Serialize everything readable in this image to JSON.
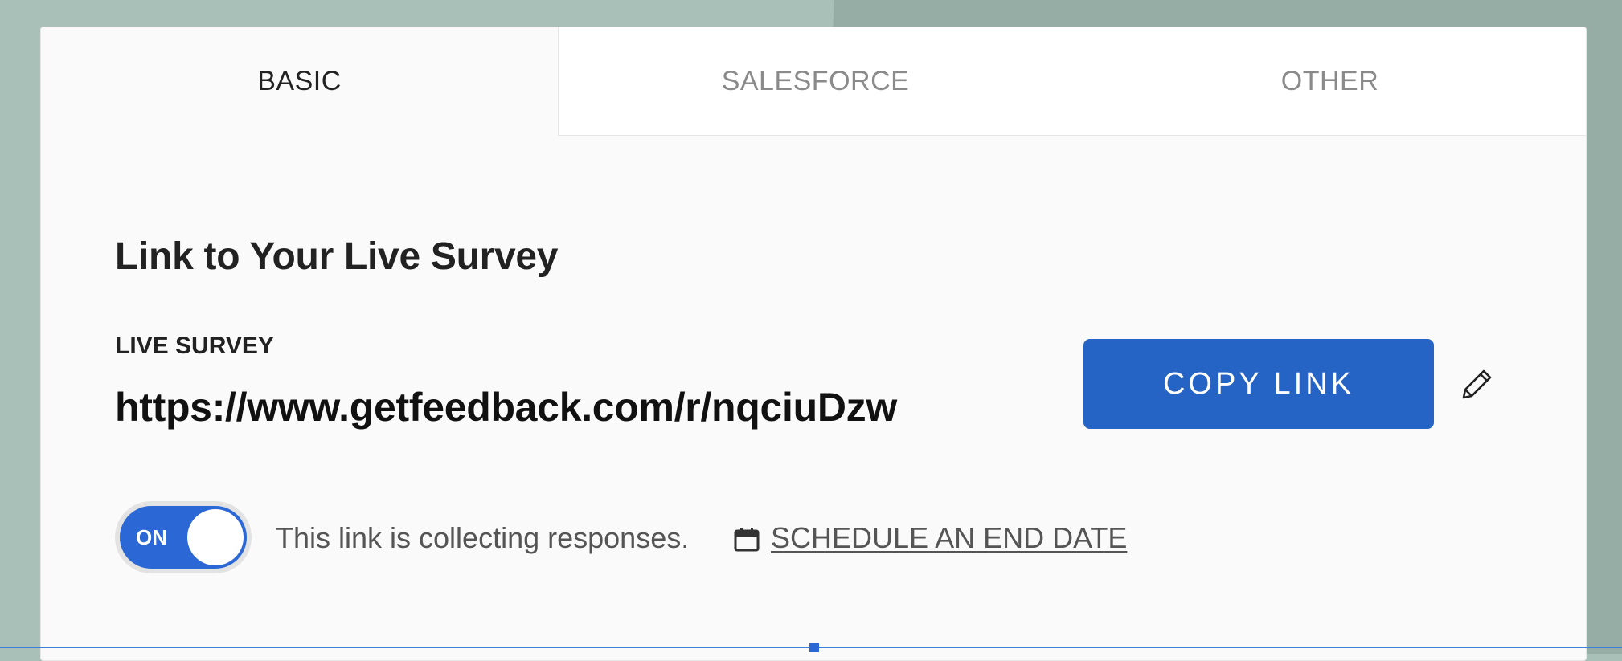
{
  "tabs": [
    {
      "label": "BASIC",
      "active": true
    },
    {
      "label": "SALESFORCE",
      "active": false
    },
    {
      "label": "OTHER",
      "active": false
    }
  ],
  "section": {
    "title": "Link to Your Live Survey"
  },
  "live_survey": {
    "label": "LIVE SURVEY",
    "url": "https://www.getfeedback.com/r/nqciuDzw"
  },
  "copy_button": {
    "label": "COPY LINK"
  },
  "collection_toggle": {
    "state_label": "ON",
    "is_on": true
  },
  "status": {
    "text": "This link is collecting responses.",
    "schedule_link": "SCHEDULE AN END DATE"
  },
  "icons": {
    "edit": "pencil-icon",
    "calendar": "calendar-icon"
  },
  "colors": {
    "accent": "#2563c5",
    "toggle_on": "#2b68d6",
    "background": "#a9c0b8",
    "card": "#fafafa"
  }
}
